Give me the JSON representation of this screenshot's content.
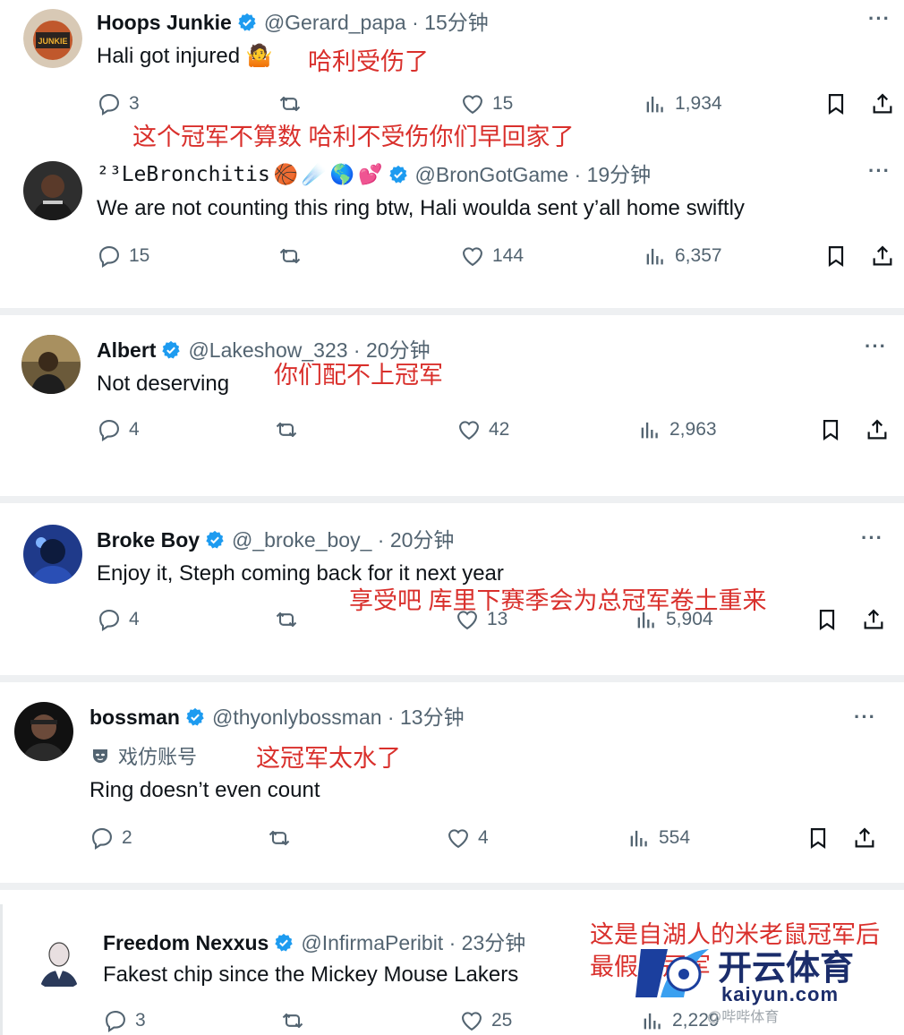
{
  "posts": [
    {
      "name": "Hoops Junkie",
      "name_emojis": [],
      "handle": "@Gerard_papa",
      "time": "15分钟",
      "body": "Hali got injured 🤷",
      "parody_label": "",
      "annotation": "哈利受伤了",
      "caption_below": "这个冠军不算数 哈利不受伤你们早回家了",
      "replies": "3",
      "likes": "15",
      "views": "1,934"
    },
    {
      "name": "²³LeBronchitis",
      "name_emojis": [
        "🏀",
        "☄️",
        "🌎",
        "💕"
      ],
      "handle": "@BronGotGame",
      "time": "19分钟",
      "body": "We are not counting this ring btw, Hali woulda sent y’all home swiftly",
      "parody_label": "",
      "annotation": "",
      "caption_below": "",
      "replies": "15",
      "likes": "144",
      "views": "6,357"
    },
    {
      "name": "Albert",
      "name_emojis": [],
      "handle": "@Lakeshow_323",
      "time": "20分钟",
      "body": "Not deserving",
      "parody_label": "",
      "annotation": "你们配不上冠军",
      "caption_below": "",
      "replies": "4",
      "likes": "42",
      "views": "2,963"
    },
    {
      "name": "Broke Boy",
      "name_emojis": [],
      "handle": "@_broke_boy_",
      "time": "20分钟",
      "body": "Enjoy it, Steph coming back for it next year",
      "parody_label": "",
      "annotation": "享受吧 库里下赛季会为总冠军卷土重来",
      "caption_below": "",
      "replies": "4",
      "likes": "13",
      "views": "5,904"
    },
    {
      "name": "bossman",
      "name_emojis": [],
      "handle": "@thyonlybossman",
      "time": "13分钟",
      "body": "Ring doesn’t even count",
      "parody_label": "戏仿账号",
      "annotation": "这冠军太水了",
      "caption_below": "",
      "replies": "2",
      "likes": "4",
      "views": "554"
    },
    {
      "name": "Freedom Nexxus",
      "name_emojis": [],
      "handle": "@InfirmaPeribit",
      "time": "23分钟",
      "body": "Fakest chip since the Mickey Mouse Lakers",
      "parody_label": "",
      "annotation": "这是自湖人的米老鼠冠军后最假的冠军",
      "caption_below": "",
      "replies": "3",
      "likes": "25",
      "views": "2,229"
    }
  ],
  "watermark": {
    "title": "开云体育",
    "url": "kaiyun.com",
    "sub": "@哔哔体育"
  },
  "colors": {
    "text": "#0f1419",
    "secondary": "#536471",
    "verified": "#1d9bf0",
    "annotation": "#d9302c",
    "separator": "#eef0f2"
  },
  "icons": [
    "verified-badge-icon",
    "more-icon",
    "reply-icon",
    "retweet-icon",
    "like-icon",
    "views-icon",
    "bookmark-icon",
    "share-icon",
    "parody-mask-icon"
  ]
}
